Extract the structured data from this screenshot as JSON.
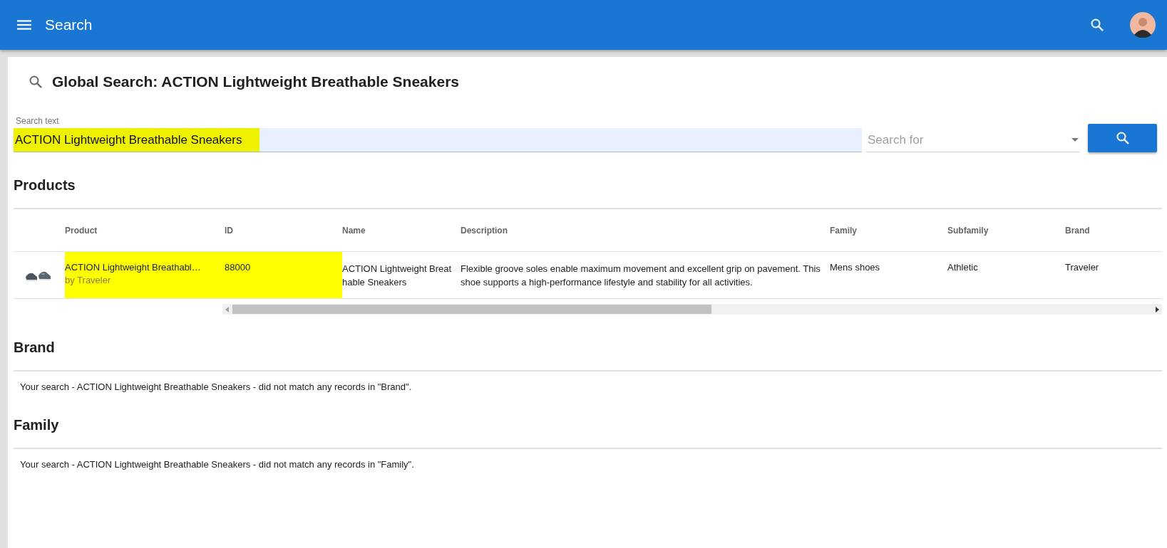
{
  "app_bar": {
    "title": "Search"
  },
  "page_title": "Global Search: ACTION Lightweight Breathable Sneakers",
  "search": {
    "label": "Search text",
    "value": "ACTION Lightweight Breathable Sneakers",
    "highlighted": true,
    "search_for": {
      "placeholder": "Search for"
    }
  },
  "sections": [
    {
      "kind": "table",
      "title": "Products",
      "table": {
        "columns": [
          "Product",
          "ID",
          "Name",
          "Description",
          "Family",
          "Subfamily",
          "Brand"
        ],
        "rows": [
          {
            "product": "ACTION Lightweight Breathabl…",
            "by": "by Traveler",
            "product_highlighted": true,
            "id": "88000",
            "id_highlighted": true,
            "name": "ACTION Lightweight Breathable Sneakers",
            "description": "Flexible groove soles enable maximum movement and excellent grip on pavement. This shoe supports a high-performance lifestyle and stability for all activities.",
            "family": "Mens shoes",
            "subfamily": "Athletic",
            "brand": "Traveler"
          }
        ]
      }
    },
    {
      "kind": "message",
      "title": "Brand",
      "message": "Your search - ACTION Lightweight Breathable Sneakers - did not match any records in \"Brand\"."
    },
    {
      "kind": "message",
      "title": "Family",
      "message": "Your search - ACTION Lightweight Breathable Sneakers - did not match any records in \"Family\"."
    }
  ]
}
